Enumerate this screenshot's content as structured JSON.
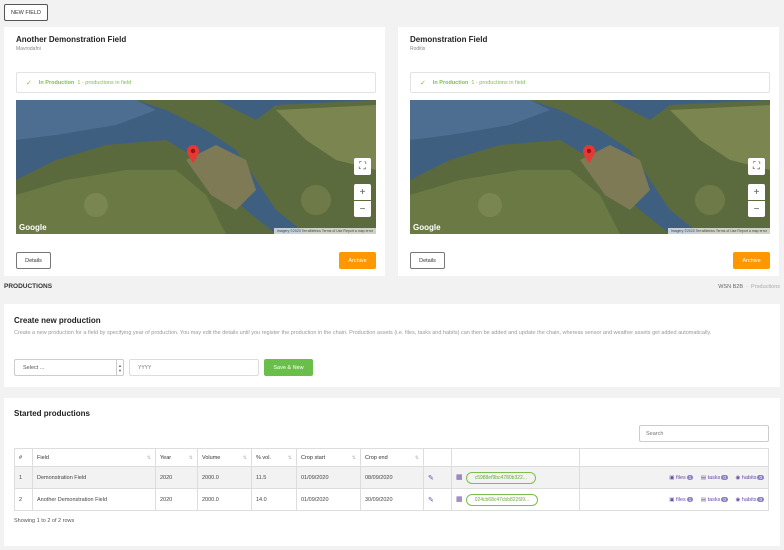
{
  "toolbar": {
    "new_field_label": "NEW FIELD"
  },
  "fields": [
    {
      "title": "Another Demonstration Field",
      "subtitle": "Mavrodafni",
      "status_bold": "In Production",
      "status_text": "1 - productions in field",
      "map_attribution": "Imagery ©2020 TerraMetrics   Terms of Use   Report a map error",
      "google_logo": "Google",
      "details_label": "Details",
      "archive_label": "Archive"
    },
    {
      "title": "Demonstration Field",
      "subtitle": "Roditis",
      "status_bold": "In Production",
      "status_text": "1 - productions in field",
      "map_attribution": "Imagery ©2020 TerraMetrics   Terms of Use   Report a map error",
      "google_logo": "Google",
      "details_label": "Details",
      "archive_label": "Archive"
    }
  ],
  "productions": {
    "heading": "PRODUCTIONS",
    "breadcrumb": [
      "WSN B2B",
      "Productions"
    ]
  },
  "create": {
    "title": "Create new production",
    "description": "Create a new production for a field by specifying year of production. You may edit the details until you register the production in the chain. Production assets (i.e. files, tasks and habits) can then be added and update the chain, whereas sensor and weather assets get added automatically.",
    "select_value": "Select ...",
    "year_placeholder": "YYYY",
    "save_label": "Save & New"
  },
  "started": {
    "title": "Started productions",
    "search_placeholder": "Search",
    "columns": [
      "#",
      "Field",
      "Year",
      "Volume",
      "% vol.",
      "Crop start",
      "Crop end"
    ],
    "rows": [
      {
        "num": "1",
        "field": "Demonstration Field",
        "year": "2020",
        "volume": "2000.0",
        "vol_pct": "11.5",
        "crop_start": "01/09/2020",
        "crop_end": "08/09/2020",
        "hash": "c5988ef9bc4780b322...",
        "files": "files",
        "files_count": "1",
        "tasks": "tasks",
        "tasks_count": "0",
        "habits": "habits",
        "habits_count": "0"
      },
      {
        "num": "2",
        "field": "Another Demonstration Field",
        "year": "2020",
        "volume": "2000.0",
        "vol_pct": "14.0",
        "crop_start": "01/09/2020",
        "crop_end": "30/09/2020",
        "hash": "024cb68c47cbb8226l9...",
        "files": "files",
        "files_count": "1",
        "tasks": "tasks",
        "tasks_count": "0",
        "habits": "habits",
        "habits_count": "0"
      }
    ],
    "showing": "Showing 1 to 2 of 2 rows"
  },
  "icons": {
    "check": "check-icon",
    "pin": "map-pin-icon",
    "fullscreen": "fullscreen-icon",
    "edit": "edit-icon",
    "qr": "grid-icon"
  },
  "colors": {
    "accent_orange": "#ff9800",
    "accent_green": "#6abf4b",
    "accent_purple": "#6a4ca8"
  }
}
